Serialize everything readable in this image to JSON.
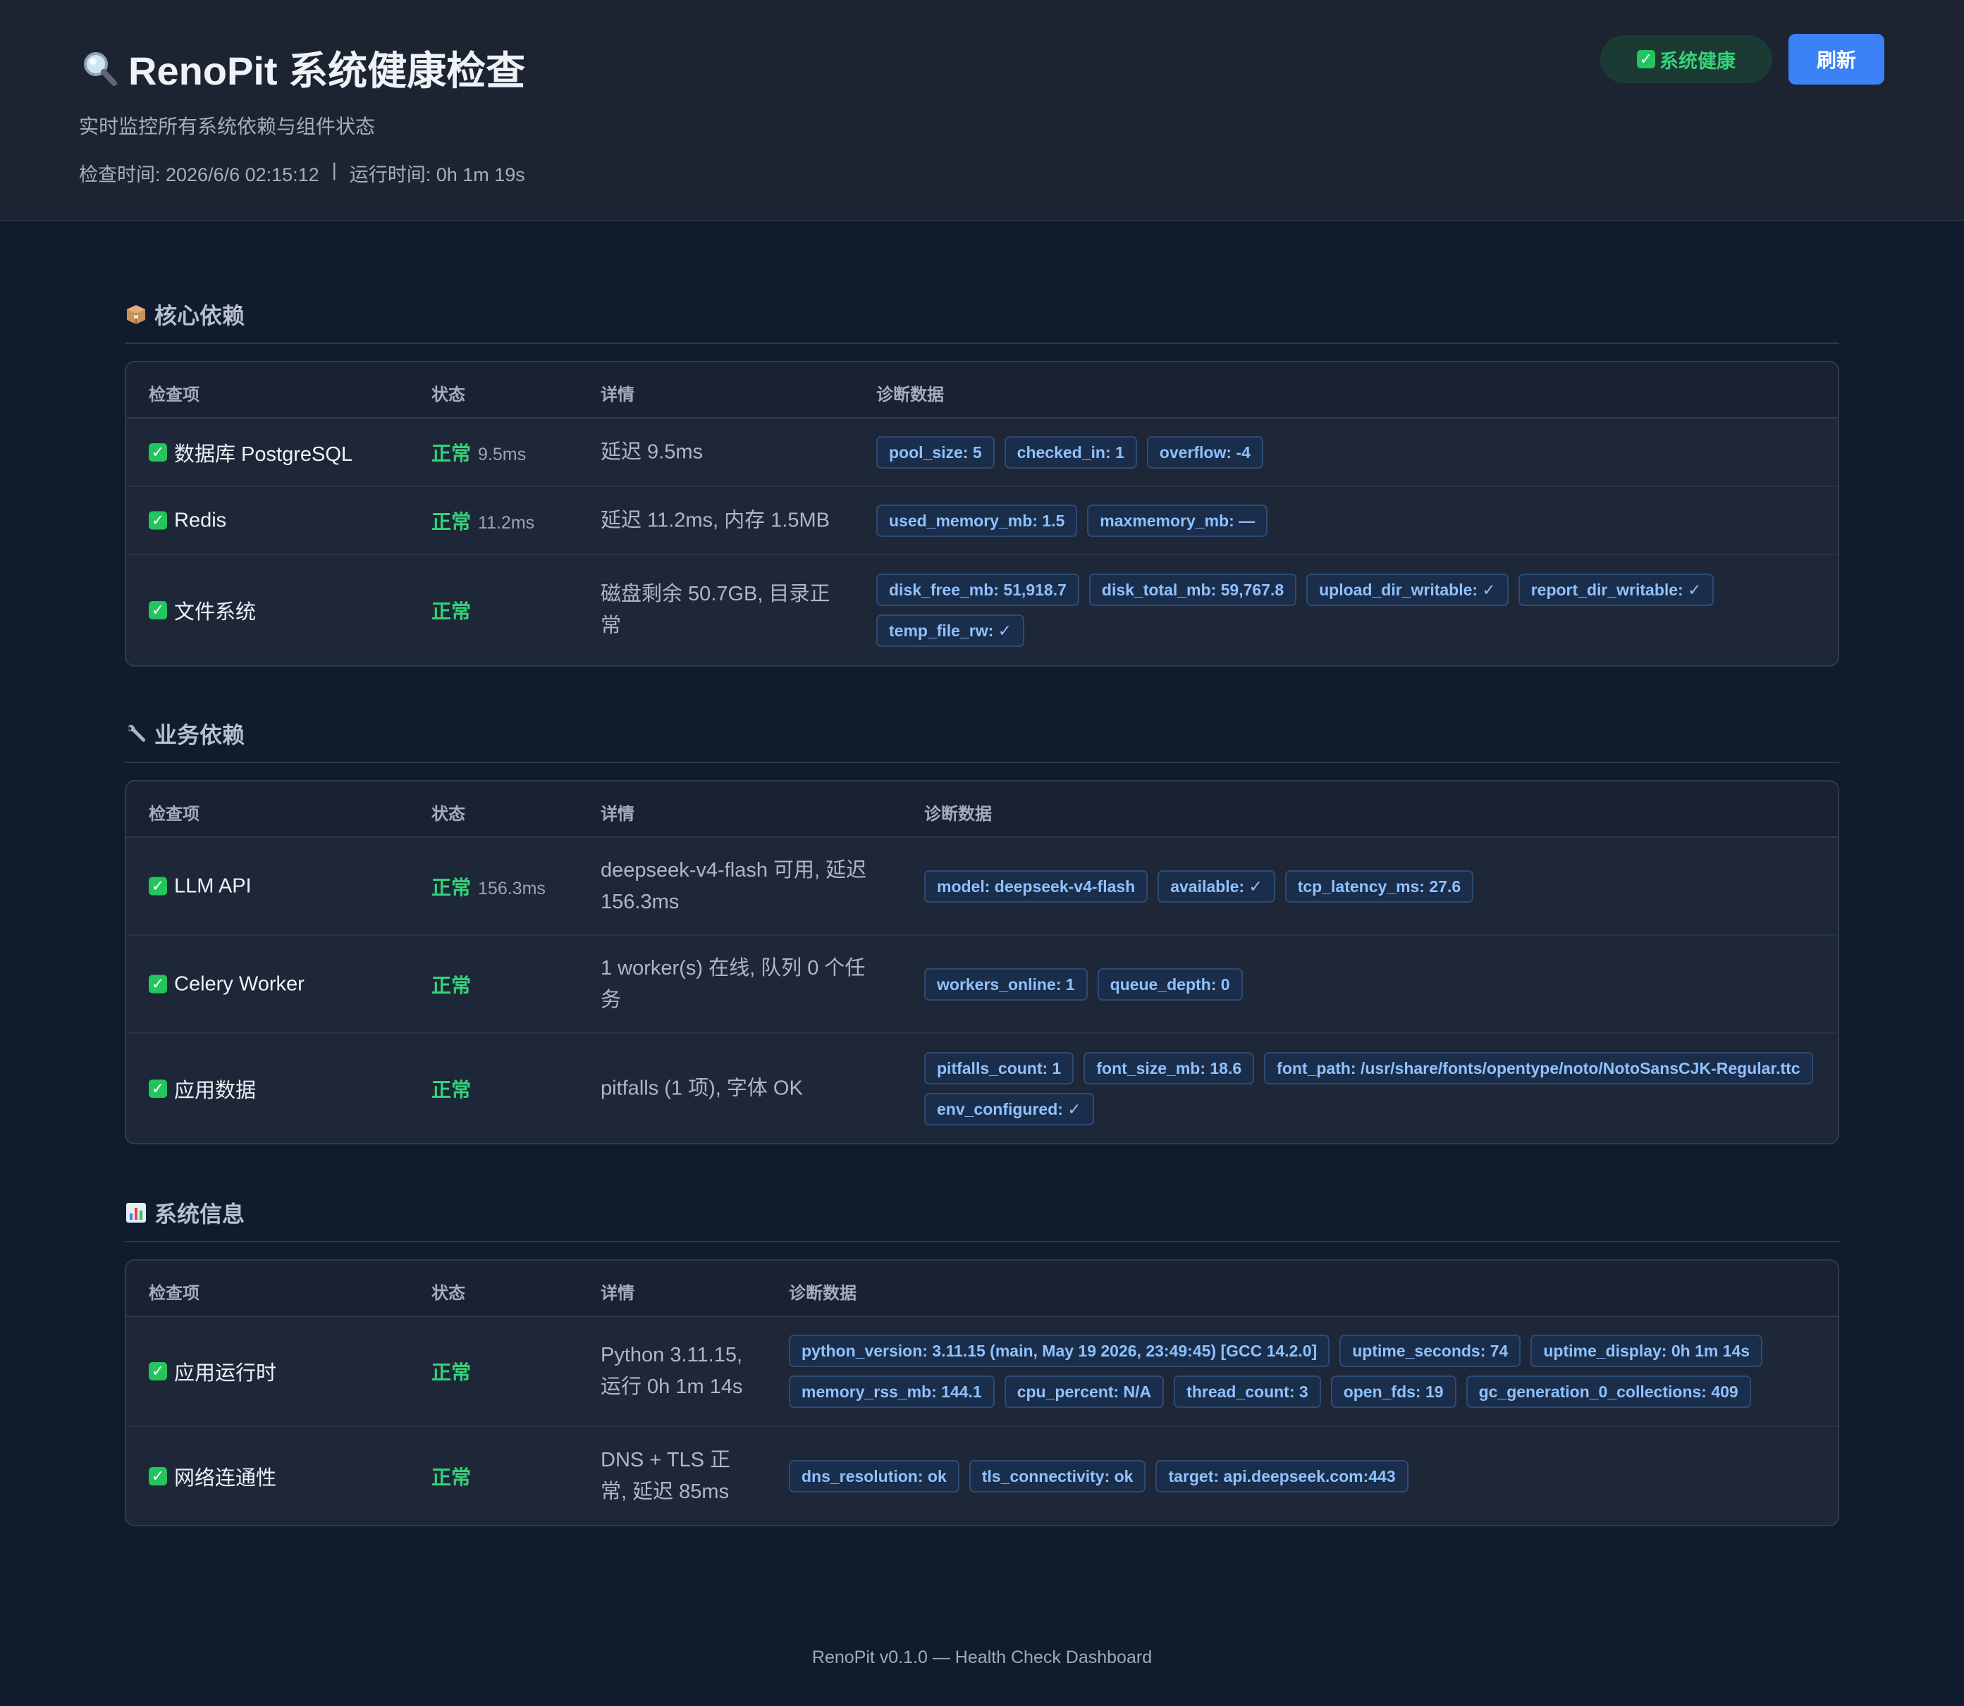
{
  "header": {
    "title": "RenoPit 系统健康检查",
    "subtitle": "实时监控所有系统依赖与组件状态",
    "check_time": "检查时间: 2026/6/6 02:15:12",
    "separator": "|",
    "uptime": "运行时间: 0h 1m 19s",
    "health_label": "系统健康",
    "refresh_label": "刷新"
  },
  "columns": {
    "name": "检查项",
    "status": "状态",
    "detail": "详情",
    "diag": "诊断数据"
  },
  "sections": {
    "core": {
      "title": "核心依赖",
      "icon": "package-icon",
      "rows": [
        {
          "name": "数据库 PostgreSQL",
          "status": "正常",
          "latency": "9.5ms",
          "detail": "延迟 9.5ms",
          "tags": [
            "pool_size: 5",
            "checked_in: 1",
            "overflow: -4"
          ]
        },
        {
          "name": "Redis",
          "status": "正常",
          "latency": "11.2ms",
          "detail": "延迟 11.2ms, 内存 1.5MB",
          "tags": [
            "used_memory_mb: 1.5",
            "maxmemory_mb: —"
          ]
        },
        {
          "name": "文件系统",
          "status": "正常",
          "latency": "",
          "detail_line1": "磁盘剩余 50.7GB, 目录正",
          "detail_line2": "常",
          "tags": [
            "disk_free_mb: 51,918.7",
            "disk_total_mb: 59,767.8",
            "upload_dir_writable: ✓",
            "report_dir_writable: ✓",
            "temp_file_rw: ✓"
          ]
        }
      ]
    },
    "business": {
      "title": "业务依赖",
      "icon": "wrench-icon",
      "rows": [
        {
          "name": "LLM API",
          "status": "正常",
          "latency": "156.3ms",
          "detail_line1": "deepseek-v4-flash 可用, 延迟",
          "detail_line2": "156.3ms",
          "tags": [
            "model: deepseek-v4-flash",
            "available: ✓",
            "tcp_latency_ms: 27.6"
          ]
        },
        {
          "name": "Celery Worker",
          "status": "正常",
          "latency": "",
          "detail_line1": "1 worker(s) 在线, 队列 0 个任",
          "detail_line2": "务",
          "tags": [
            "workers_online: 1",
            "queue_depth: 0"
          ]
        },
        {
          "name": "应用数据",
          "status": "正常",
          "latency": "",
          "detail": "pitfalls (1 项), 字体 OK",
          "tags": [
            "pitfalls_count: 1",
            "font_size_mb: 18.6",
            "font_path: /usr/share/fonts/opentype/noto/NotoSansCJK-Regular.ttc",
            "env_configured: ✓"
          ]
        }
      ]
    },
    "system": {
      "title": "系统信息",
      "icon": "bar-chart-icon",
      "rows": [
        {
          "name": "应用运行时",
          "status": "正常",
          "latency": "",
          "detail_line1": "Python 3.11.15,",
          "detail_line2": "运行 0h 1m 14s",
          "tags": [
            "python_version: 3.11.15 (main, May 19 2026, 23:49:45) [GCC 14.2.0]",
            "uptime_seconds: 74",
            "uptime_display: 0h 1m 14s",
            "memory_rss_mb: 144.1",
            "cpu_percent: N/A",
            "thread_count: 3",
            "open_fds: 19",
            "gc_generation_0_collections: 409"
          ]
        },
        {
          "name": "网络连通性",
          "status": "正常",
          "latency": "",
          "detail_line1": "DNS + TLS 正",
          "detail_line2": "常, 延迟 85ms",
          "tags": [
            "dns_resolution: ok",
            "tls_connectivity: ok",
            "target: api.deepseek.com:443"
          ]
        }
      ]
    }
  },
  "footer": "RenoPit v0.1.0 — Health Check Dashboard",
  "colors": {
    "accent": "#3b82f6",
    "ok": "#34d27a",
    "tag_text": "#8fc1ff"
  }
}
